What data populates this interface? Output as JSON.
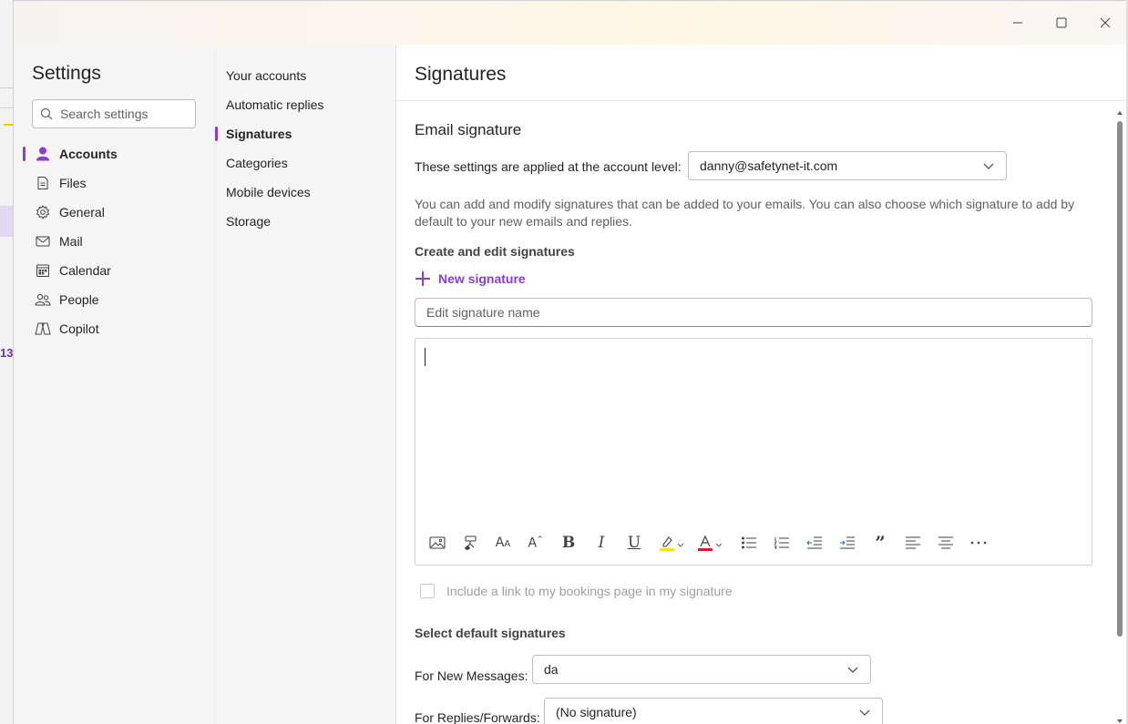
{
  "window": {
    "minimize_icon": "minimize-icon",
    "maximize_icon": "maximize-icon",
    "close_icon": "close-icon"
  },
  "background": {
    "visible_number": "13"
  },
  "settings": {
    "title": "Settings",
    "search": {
      "placeholder": "Search settings",
      "value": "",
      "icon": "search-icon"
    },
    "items": [
      {
        "label": "Accounts",
        "icon": "person-icon",
        "active": true
      },
      {
        "label": "Files",
        "icon": "document-icon",
        "active": false
      },
      {
        "label": "General",
        "icon": "gear-icon",
        "active": false
      },
      {
        "label": "Mail",
        "icon": "mail-icon",
        "active": false
      },
      {
        "label": "Calendar",
        "icon": "calendar-icon",
        "active": false
      },
      {
        "label": "People",
        "icon": "people-icon",
        "active": false
      },
      {
        "label": "Copilot",
        "icon": "copilot-icon",
        "active": false
      }
    ]
  },
  "subnav": {
    "items": [
      {
        "label": "Your accounts",
        "active": false
      },
      {
        "label": "Automatic replies",
        "active": false
      },
      {
        "label": "Signatures",
        "active": true
      },
      {
        "label": "Categories",
        "active": false
      },
      {
        "label": "Mobile devices",
        "active": false
      },
      {
        "label": "Storage",
        "active": false
      }
    ]
  },
  "content": {
    "page_title": "Signatures",
    "section_title": "Email signature",
    "account_label": "These settings are applied at the account level:",
    "account_value": "danny@safetynet-it.com",
    "description": "You can add and modify signatures that can be added to your emails. You can also choose which signature to add by default to your new emails and replies.",
    "create_title": "Create and edit signatures",
    "new_signature_label": "New signature",
    "signature_name": {
      "placeholder": "Edit signature name",
      "value": ""
    },
    "toolbar": [
      "insert-picture-icon",
      "format-painter-icon",
      "font-size-icon",
      "text-effects-icon",
      "bold-icon",
      "italic-icon",
      "underline-icon",
      "highlight-icon",
      "font-color-icon",
      "bullets-icon",
      "numbering-icon",
      "decrease-indent-icon",
      "increase-indent-icon",
      "quote-icon",
      "align-left-icon",
      "center-icon",
      "more-options-icon"
    ],
    "bookings_label": "Include a link to my bookings page in my signature",
    "defaults_title": "Select default signatures",
    "new_messages_label": "For New Messages:",
    "new_messages_value": "da",
    "replies_label": "For Replies/Forwards:",
    "replies_value": "(No signature)"
  },
  "colors": {
    "accent": "#8a3fcf",
    "highlight_yellow": "#f2e60c",
    "font_red": "#c4262e"
  }
}
